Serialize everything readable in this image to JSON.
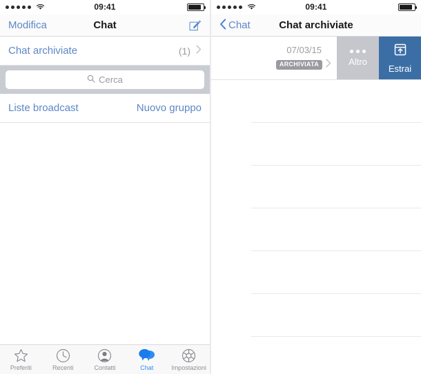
{
  "left": {
    "statusbar": {
      "time": "09:41",
      "signal_dots": 5,
      "wifi_icon": "wifi-icon",
      "battery_icon": "battery-icon"
    },
    "navbar": {
      "left_label": "Modifica",
      "title": "Chat",
      "right_icon": "compose-icon"
    },
    "rows": [
      {
        "label": "Chat archiviate",
        "count": "(1)",
        "chevron": "chevron-right-icon"
      }
    ],
    "search": {
      "placeholder": "Cerca",
      "icon": "search-icon",
      "value": ""
    },
    "actions": {
      "broadcast_label": "Liste broadcast",
      "new_group_label": "Nuovo gruppo"
    },
    "tabbar": [
      {
        "label": "Preferiti",
        "icon": "star-icon",
        "active": false
      },
      {
        "label": "Recenti",
        "icon": "clock-icon",
        "active": false
      },
      {
        "label": "Contatti",
        "icon": "person-icon",
        "active": false
      },
      {
        "label": "Chat",
        "icon": "chat-bubbles-icon",
        "active": true
      },
      {
        "label": "Impostazioni",
        "icon": "gear-icon",
        "active": false
      }
    ]
  },
  "right": {
    "statusbar": {
      "time": "09:41",
      "signal_dots": 5,
      "wifi_icon": "wifi-icon",
      "battery_icon": "battery-icon"
    },
    "navbar": {
      "back_label": "Chat",
      "back_icon": "chevron-left-icon",
      "title": "Chat archiviate"
    },
    "swipe_row": {
      "date": "07/03/15",
      "badge": "ARCHIVIATA",
      "chevron": "chevron-right-icon",
      "more_label": "Altro",
      "more_icon": "ellipsis-icon",
      "unarchive_label": "Estrai",
      "unarchive_icon": "unarchive-box-icon"
    },
    "empty_rows": 7
  },
  "colors": {
    "tint_blue": "#5d87c8",
    "active_blue": "#2f8cf0",
    "action_blue": "#3b6ea5",
    "action_gray": "#c5c7cc",
    "badge_gray": "#9a9aa0",
    "search_band": "#c9ccd2"
  }
}
